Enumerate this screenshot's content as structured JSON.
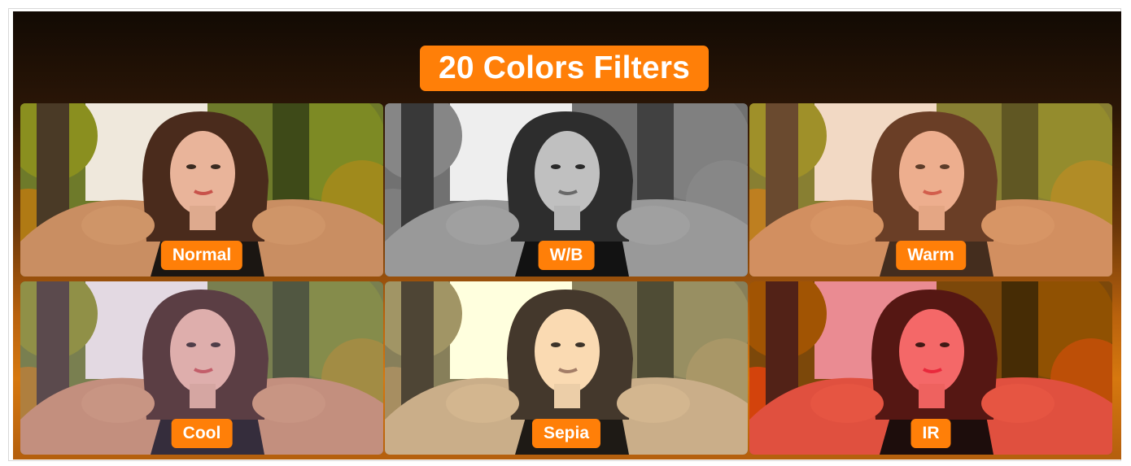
{
  "banner": {
    "title": "20 Colors Filters"
  },
  "filters": [
    {
      "label": "Normal"
    },
    {
      "label": "W/B"
    },
    {
      "label": "Warm"
    },
    {
      "label": "Cool"
    },
    {
      "label": "Sepia"
    },
    {
      "label": "IR"
    }
  ],
  "colors": {
    "accent": "#ff7f08",
    "label_text": "#ffffff",
    "background_top": "#120a04",
    "background_bottom": "#d6780f"
  }
}
